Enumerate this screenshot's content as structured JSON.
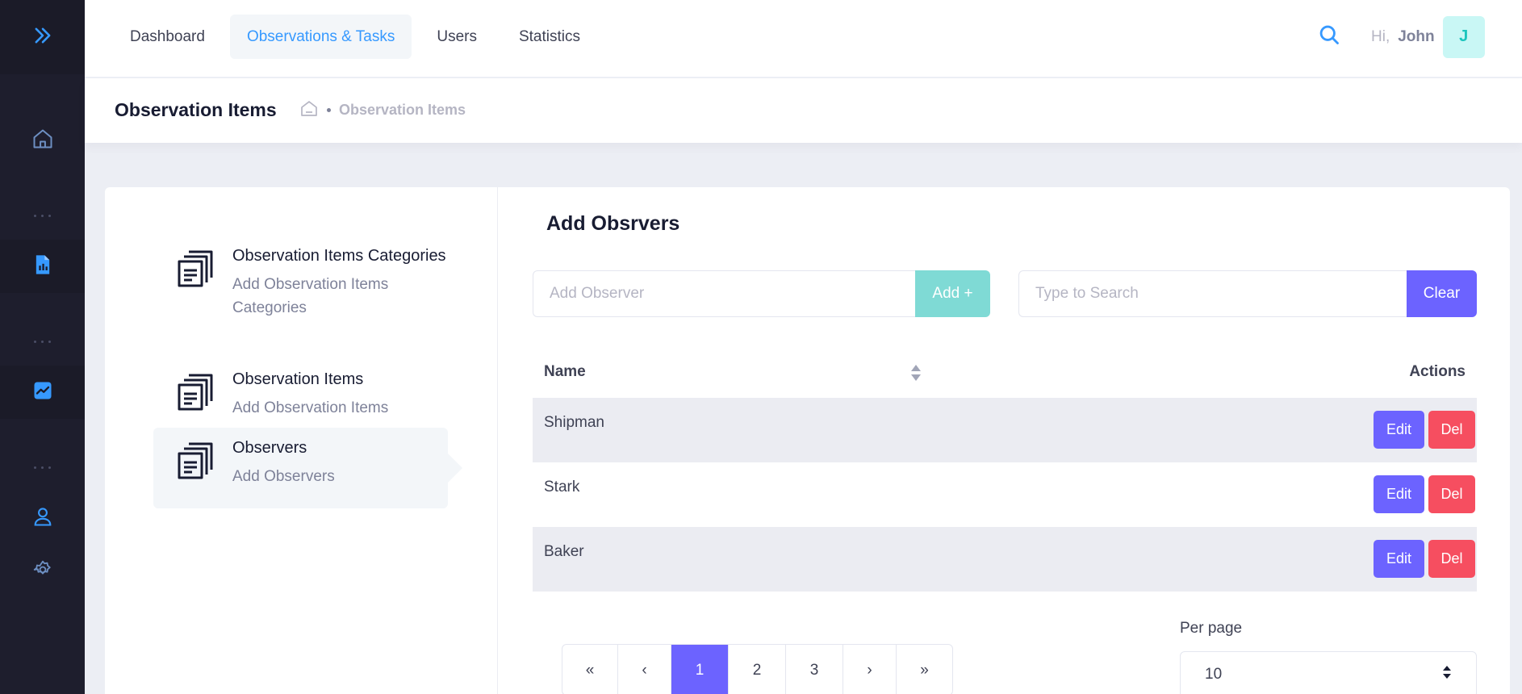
{
  "nav": {
    "items": [
      {
        "label": "Dashboard"
      },
      {
        "label": "Observations & Tasks"
      },
      {
        "label": "Users"
      },
      {
        "label": "Statistics"
      }
    ],
    "active": "Observations & Tasks"
  },
  "user": {
    "greeting": "Hi,",
    "name": "John",
    "initial": "J"
  },
  "subheader": {
    "title": "Observation Items",
    "breadcrumb": "Observation Items"
  },
  "menu": [
    {
      "title": "Observation Items Categories",
      "subtitle": "Add Observation Items Categories",
      "active": false
    },
    {
      "title": "Observation Items",
      "subtitle": "Add Observation Items",
      "active": false
    },
    {
      "title": "Observers",
      "subtitle": "Add Observers",
      "active": true
    }
  ],
  "section": {
    "title": "Add Obsrvers"
  },
  "add_form": {
    "placeholder": "Add Observer",
    "button": "Add +"
  },
  "search_form": {
    "placeholder": "Type to Search",
    "button": "Clear"
  },
  "table": {
    "columns": [
      "Name",
      "Actions"
    ],
    "rows": [
      {
        "name": "Shipman"
      },
      {
        "name": "Stark"
      },
      {
        "name": "Baker"
      }
    ],
    "edit_label": "Edit",
    "delete_label": "Del"
  },
  "pagination": {
    "first": "«",
    "prev": "‹",
    "pages": [
      "1",
      "2",
      "3"
    ],
    "current": "1",
    "next": "›",
    "last": "»"
  },
  "per_page": {
    "label": "Per page",
    "value": "10"
  },
  "colors": {
    "primary": "#6c63ff",
    "accent": "#3699ff",
    "danger": "#f64e60",
    "success_light": "#7fdad5",
    "sidebar": "#1e1e2d"
  }
}
